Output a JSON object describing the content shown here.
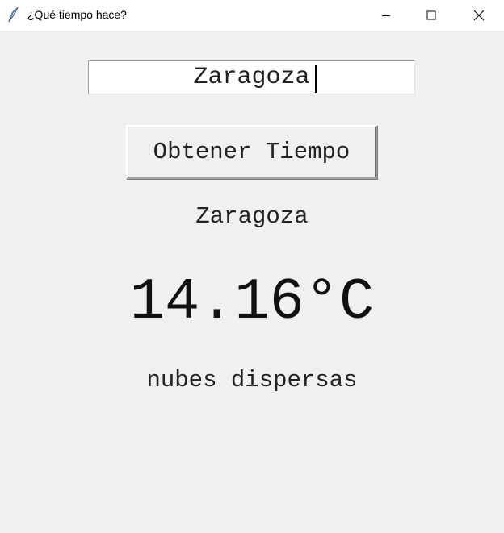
{
  "window": {
    "title": "¿Qué tiempo hace?",
    "icon": "feather-icon"
  },
  "search": {
    "value": "Zaragoza"
  },
  "button": {
    "label": "Obtener Tiempo"
  },
  "result": {
    "city": "Zaragoza",
    "temperature": "14.16°C",
    "description": "nubes dispersas"
  }
}
